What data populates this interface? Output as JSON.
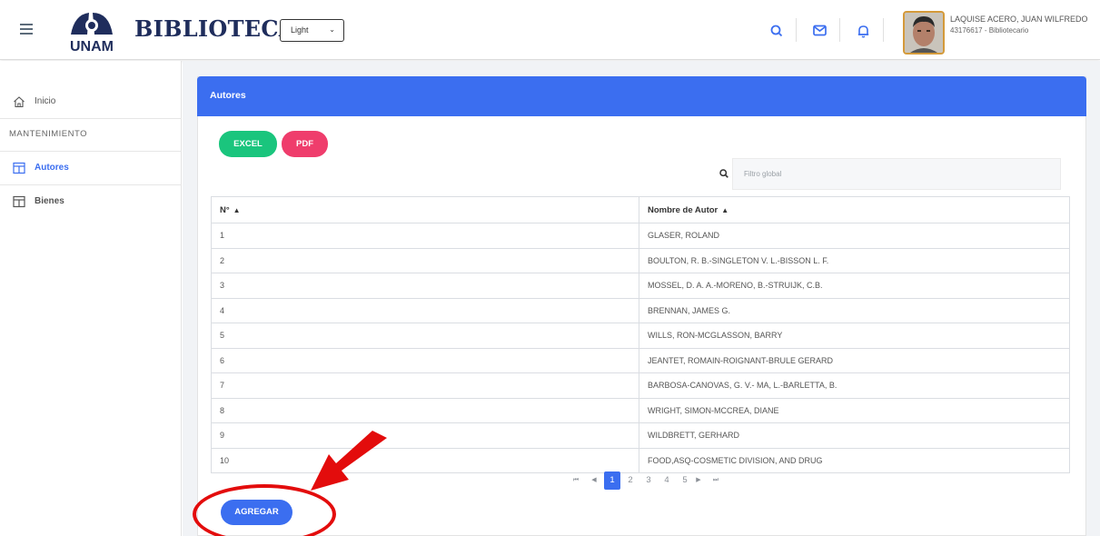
{
  "header": {
    "brand": "BIBLIOTECA",
    "logo_text": "UNAM",
    "theme_select": "Light",
    "user_name": "LAQUISE ACERO, JUAN WILFREDO",
    "user_role": "43176617 - Bibliotecario"
  },
  "sidebar": {
    "inicio": "Inicio",
    "section": "MANTENIMIENTO",
    "items": [
      {
        "label": "Autores"
      },
      {
        "label": "Bienes"
      }
    ]
  },
  "main": {
    "title": "Autores",
    "excel_label": "EXCEL",
    "pdf_label": "PDF",
    "filter_placeholder": "Filtro global",
    "columns": [
      "N°",
      "Nombre de Autor"
    ],
    "rows": [
      {
        "n": "1",
        "name": "GLASER, ROLAND"
      },
      {
        "n": "2",
        "name": "BOULTON, R. B.-SINGLETON V. L.-BISSON L. F."
      },
      {
        "n": "3",
        "name": "MOSSEL, D. A. A.-MORENO, B.-STRUIJK, C.B."
      },
      {
        "n": "4",
        "name": "BRENNAN, JAMES G."
      },
      {
        "n": "5",
        "name": "WILLS, RON-MCGLASSON, BARRY"
      },
      {
        "n": "6",
        "name": "JEANTET, ROMAIN-ROIGNANT-BRULE GERARD"
      },
      {
        "n": "7",
        "name": "BARBOSA-CANOVAS, G. V.- MA, L.-BARLETTA, B."
      },
      {
        "n": "8",
        "name": "WRIGHT, SIMON-MCCREA, DIANE"
      },
      {
        "n": "9",
        "name": "WILDBRETT, GERHARD"
      },
      {
        "n": "10",
        "name": "FOOD,ASQ-COSMETIC DIVISION, AND DRUG"
      }
    ],
    "pagination": {
      "pages": [
        "1",
        "2",
        "3",
        "4",
        "5"
      ],
      "current": "1"
    },
    "add_label": "AGREGAR"
  },
  "colors": {
    "primary": "#3b6ef0",
    "excel": "#1ac57d",
    "pdf": "#ef3d6c",
    "annotation": "#e30c0c"
  }
}
